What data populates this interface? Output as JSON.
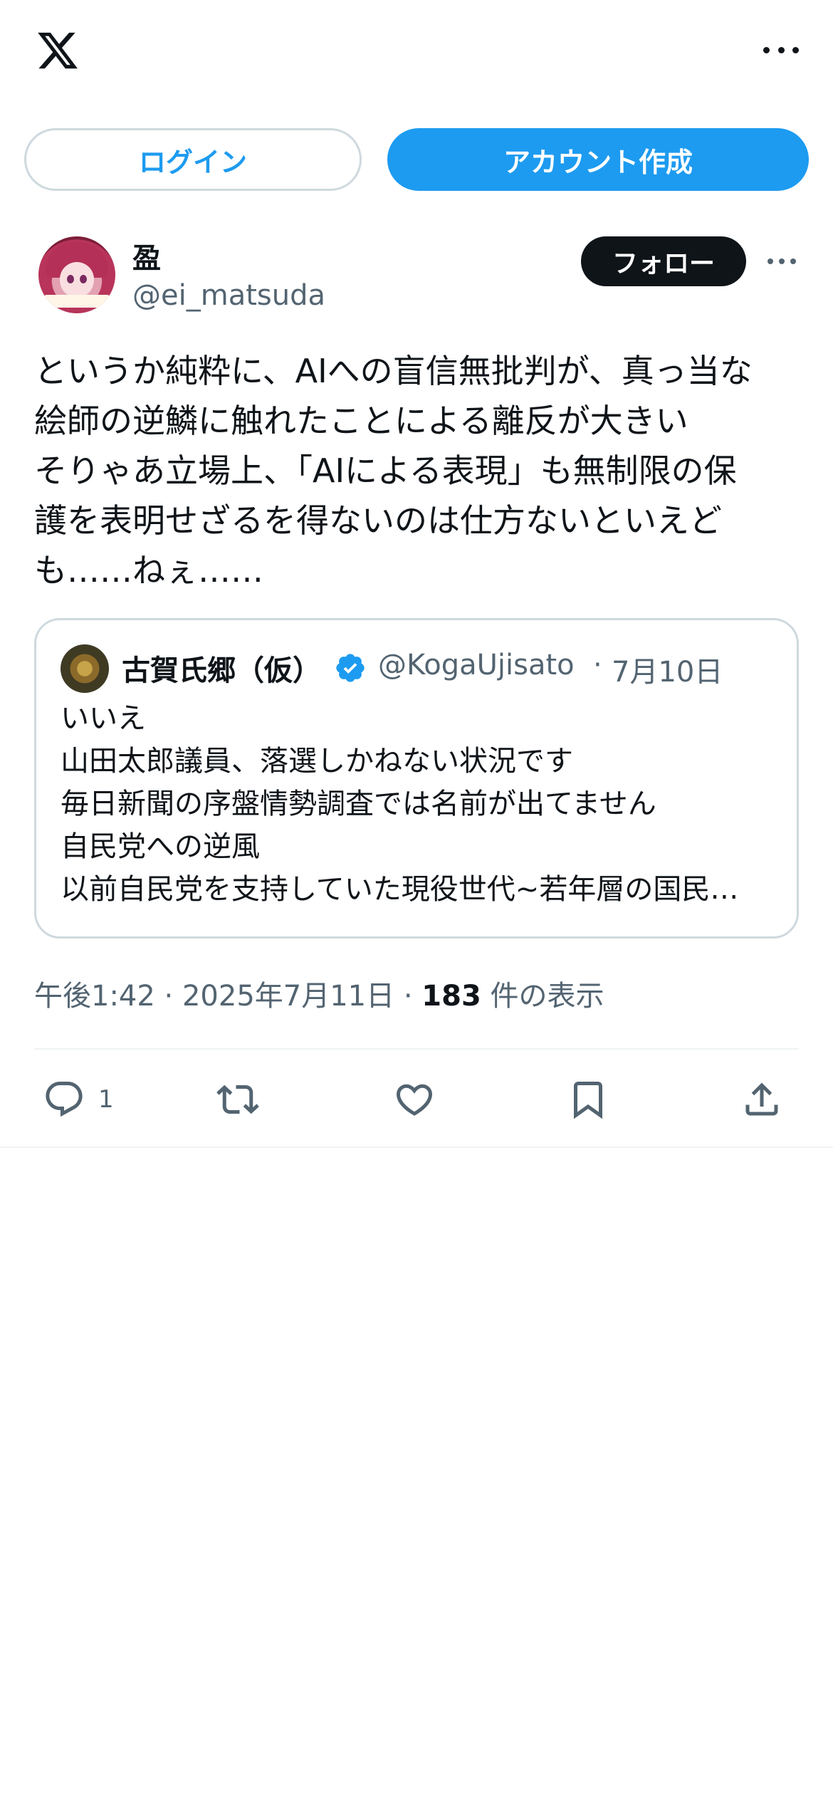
{
  "header": {
    "logo_icon": "x-logo-icon",
    "more_icon": "more-horizontal-icon"
  },
  "auth": {
    "login_label": "ログイン",
    "signup_label": "アカウント作成"
  },
  "post": {
    "author_name": "盈",
    "author_handle": "@ei_matsuda",
    "follow_label": "フォロー",
    "text": "というか純粋に、AIへの盲信無批判が、真っ当な\n絵師の逆鱗に触れたことによる離反が大きい\nそりゃあ立場上、「AIによる表現」も無制限の保\n護を表明せざるを得ないのは仕方ないといえど\nも……ねぇ……",
    "time": "午後1:42",
    "date": "2025年7月11日",
    "view_count": "183",
    "view_suffix": "件の表示",
    "separator": "·"
  },
  "quote": {
    "author_name": "古賀氏郷（仮）",
    "verified_icon": "verified-badge-icon",
    "handle": "@KogaUjisato",
    "date": "7月10日",
    "lines": [
      "いいえ",
      "山田太郎議員、落選しかねない状況です",
      "毎日新聞の序盤情勢調査では名前が出てません",
      "自民党への逆風",
      "以前自民党を支持していた現役世代~若年層の国民…"
    ]
  },
  "actions": {
    "reply_count": "1",
    "icons": [
      "reply-icon",
      "retweet-icon",
      "like-icon",
      "bookmark-icon",
      "share-icon"
    ]
  },
  "colors": {
    "accent": "#1d9bf0",
    "text": "#0f1419",
    "muted": "#536471",
    "border": "#cfd9de"
  }
}
